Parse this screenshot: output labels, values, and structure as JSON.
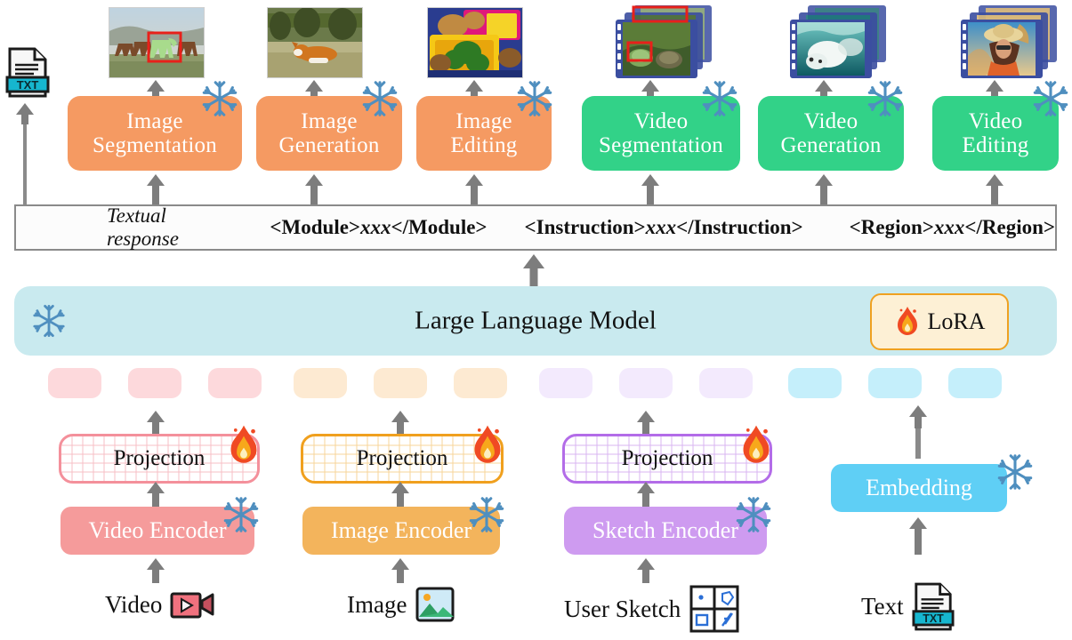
{
  "figure": {
    "title": "Unified multimodal LLM architecture with modular generation heads",
    "llm_label": "Large Language Model",
    "lora_label": "LoRA"
  },
  "colors": {
    "image_module": "#F59A62",
    "video_module": "#32D288",
    "llm_bar": "#C9EAEF",
    "lora_fill": "#FDF0D5",
    "lora_border": "#EFA121",
    "snowflake": "#4F8FBF",
    "arrow": "#7D7D7D",
    "token_pink": "#FDD9DC",
    "token_orange": "#FDEAD2",
    "token_purple": "#F3EAFD",
    "token_blue": "#C5EFFB",
    "video_encoder": "#F59B9B",
    "image_encoder": "#F3B45C",
    "sketch_encoder": "#CE9BF0",
    "embedding": "#5FCFF5",
    "proj_pink_border": "#F4909B",
    "proj_orange_border": "#F0A01E",
    "proj_purple_border": "#B36CE8",
    "response_bar_border": "#8A8A8A"
  },
  "modules": [
    {
      "label_line1": "Image",
      "label_line2": "Segmentation",
      "type": "image",
      "frozen": true
    },
    {
      "label_line1": "Image",
      "label_line2": "Generation",
      "type": "image",
      "frozen": true
    },
    {
      "label_line1": "Image",
      "label_line2": "Editing",
      "type": "image",
      "frozen": true
    },
    {
      "label_line1": "Video",
      "label_line2": "Segmentation",
      "type": "video",
      "frozen": true
    },
    {
      "label_line1": "Video",
      "label_line2": "Generation",
      "type": "video",
      "frozen": true
    },
    {
      "label_line1": "Video",
      "label_line2": "Editing",
      "type": "video",
      "frozen": true
    }
  ],
  "outputs": [
    {
      "kind": "image",
      "caption": "horses with segmented horse in red box"
    },
    {
      "kind": "image",
      "caption": "corgi lying on grass"
    },
    {
      "kind": "image",
      "caption": "bento lunch box with food"
    },
    {
      "kind": "video",
      "caption": "turtles with red bounding boxes"
    },
    {
      "kind": "video",
      "caption": "polar bear swimming underwater"
    },
    {
      "kind": "video",
      "caption": "woman wearing straw hat and sunglasses"
    }
  ],
  "response_bar": {
    "items": [
      {
        "text": "Textual response",
        "style": "italic"
      },
      {
        "open": "<Module>",
        "mid": "xxx",
        "close": "</Module>",
        "style": "tag"
      },
      {
        "open": "<Instruction>",
        "mid": "xxx",
        "close": "</Instruction>",
        "style": "tag"
      },
      {
        "open": "<Region>",
        "mid": "xxx",
        "close": "</Region>",
        "style": "tag"
      }
    ]
  },
  "tokens": {
    "groups": [
      {
        "name": "video-tokens",
        "color": "#FDD9DC",
        "count": 3
      },
      {
        "name": "image-tokens",
        "color": "#FDEAD2",
        "count": 3
      },
      {
        "name": "sketch-tokens",
        "color": "#F3EAFD",
        "count": 3
      },
      {
        "name": "text-tokens",
        "color": "#C5EFFB",
        "count": 3
      }
    ]
  },
  "branches": [
    {
      "id": "video",
      "projection_label": "Projection",
      "projection_trainable": true,
      "encoder_label": "Video Encoder",
      "encoder_frozen": true,
      "input_label": "Video",
      "input_icon": "video-camera-icon"
    },
    {
      "id": "image",
      "projection_label": "Projection",
      "projection_trainable": true,
      "encoder_label": "Image Encoder",
      "encoder_frozen": true,
      "input_label": "Image",
      "input_icon": "picture-icon"
    },
    {
      "id": "sketch",
      "projection_label": "Projection",
      "projection_trainable": true,
      "encoder_label": "Sketch Encoder",
      "encoder_frozen": true,
      "input_label": "User Sketch",
      "input_icon": "sketch-grid-icon"
    },
    {
      "id": "text",
      "projection_label": null,
      "projection_trainable": false,
      "encoder_label": "Embedding",
      "encoder_frozen": true,
      "input_label": "Text",
      "input_icon": "txt-file-icon"
    }
  ],
  "text_output_icon": {
    "name": "txt-file-icon",
    "label": "TXT"
  }
}
